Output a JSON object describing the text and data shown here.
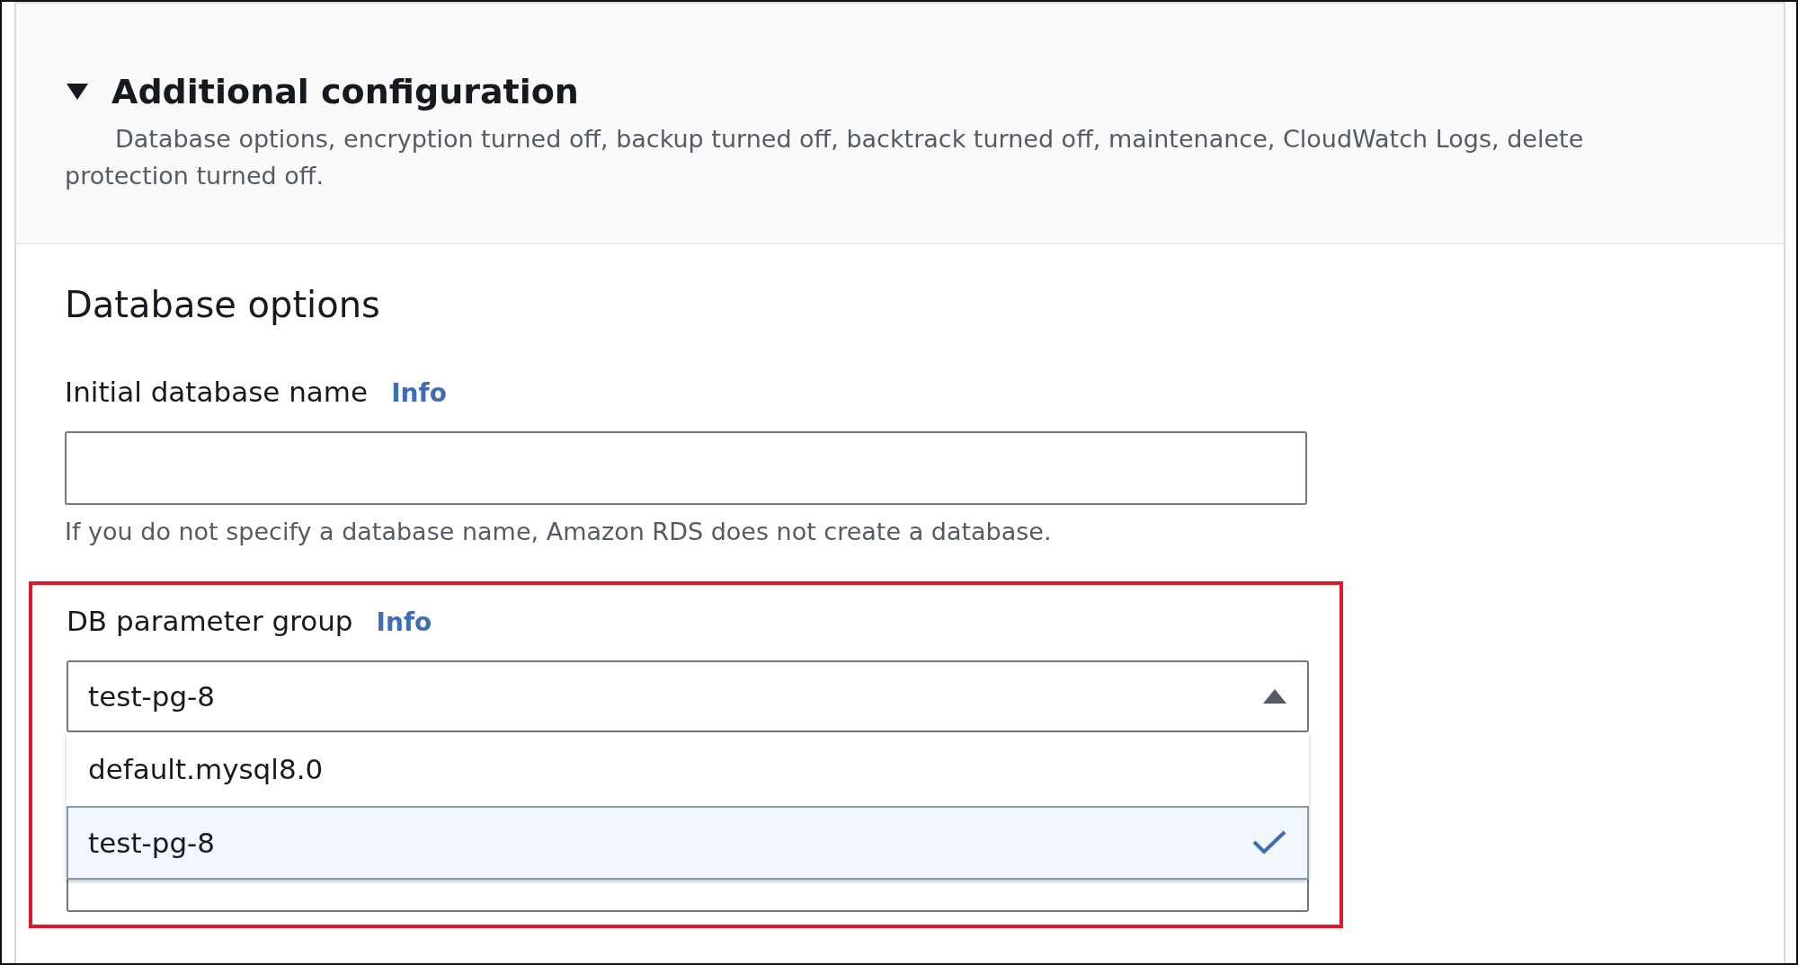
{
  "section": {
    "title": "Additional configuration",
    "expanded": true,
    "description": "Database options, encryption turned off, backup turned off, backtrack turned off, maintenance, CloudWatch Logs, delete protection turned off."
  },
  "database_options": {
    "heading": "Database options",
    "initial_name": {
      "label": "Initial database name",
      "info": "Info",
      "help": "If you do not specify a database name, Amazon RDS does not create a database."
    },
    "parameter_group": {
      "label": "DB parameter group",
      "info": "Info",
      "value": "test-pg-8",
      "expanded": true,
      "highlighted": true,
      "options": [
        {
          "label": "default.mysql8.0",
          "selected": false
        },
        {
          "label": "test-pg-8",
          "selected": true
        }
      ]
    }
  }
}
